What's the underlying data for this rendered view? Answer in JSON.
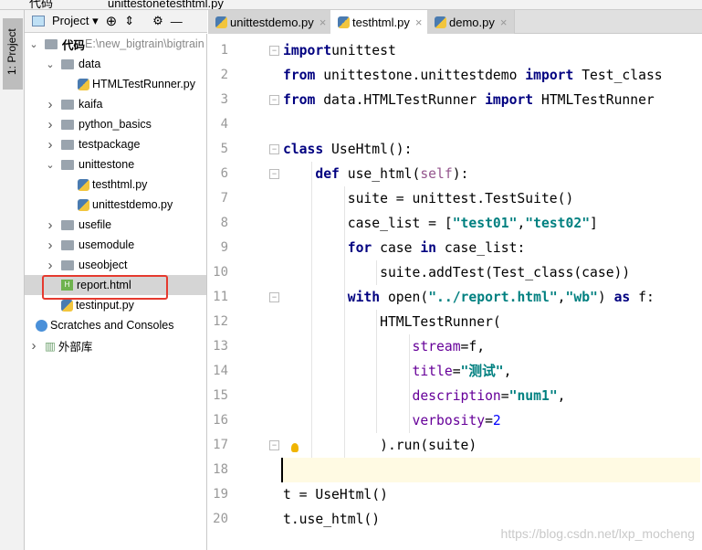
{
  "breadcrumb": [
    "代码",
    "unittestone",
    "testhtml.py"
  ],
  "tool_window": {
    "label": "1: Project",
    "title": "Project"
  },
  "tree": [
    {
      "label": "代码",
      "path": "E:\\new_bigtrain\\bigtrain",
      "type": "folder",
      "depth": 0,
      "expanded": true
    },
    {
      "label": "data",
      "type": "folder",
      "depth": 1,
      "expanded": true
    },
    {
      "label": "HTMLTestRunner.py",
      "type": "py",
      "depth": 2
    },
    {
      "label": "kaifa",
      "type": "folder",
      "depth": 1,
      "expanded": false
    },
    {
      "label": "python_basics",
      "type": "folder",
      "depth": 1,
      "expanded": false
    },
    {
      "label": "testpackage",
      "type": "folder",
      "depth": 1,
      "expanded": false
    },
    {
      "label": "unittestone",
      "type": "folder",
      "depth": 1,
      "expanded": true
    },
    {
      "label": "testhtml.py",
      "type": "py",
      "depth": 2
    },
    {
      "label": "unittestdemo.py",
      "type": "py",
      "depth": 2
    },
    {
      "label": "usefile",
      "type": "folder",
      "depth": 1,
      "expanded": false
    },
    {
      "label": "usemodule",
      "type": "folder",
      "depth": 1,
      "expanded": false
    },
    {
      "label": "useobject",
      "type": "folder",
      "depth": 1,
      "expanded": false
    },
    {
      "label": "report.html",
      "type": "html",
      "depth": 1,
      "selected": true
    },
    {
      "label": "testinput.py",
      "type": "py",
      "depth": 1
    },
    {
      "label": "Scratches and Consoles",
      "type": "scratch",
      "depth": 0
    },
    {
      "label": "外部库",
      "type": "lib",
      "depth": 0,
      "expanded": false
    }
  ],
  "tabs": [
    {
      "label": "unittestdemo.py"
    },
    {
      "label": "testhtml.py",
      "active": true
    },
    {
      "label": "demo.py"
    }
  ],
  "code": [
    [
      [
        "kw",
        "import"
      ],
      [
        "",
        "unittest"
      ]
    ],
    [
      [
        "kw",
        "from"
      ],
      [
        "",
        " unittestone.unittestdemo "
      ],
      [
        "kw",
        "import"
      ],
      [
        "",
        " Test_class"
      ]
    ],
    [
      [
        "kw",
        "from"
      ],
      [
        "",
        " data.HTMLTestRunner "
      ],
      [
        "kw",
        "import"
      ],
      [
        "",
        " HTMLTestRunner"
      ]
    ],
    [],
    [
      [
        "kw",
        "class"
      ],
      [
        "",
        " UseHtml():"
      ]
    ],
    [
      [
        "",
        "    "
      ],
      [
        "kw",
        "def"
      ],
      [
        "",
        " use_html("
      ],
      [
        "self",
        "self"
      ],
      [
        "",
        "):"
      ]
    ],
    [
      [
        "",
        "        suite = unittest.TestSuite()"
      ]
    ],
    [
      [
        "",
        "        case_list = ["
      ],
      [
        "str",
        "\"test01\""
      ],
      [
        "",
        ","
      ],
      [
        "str",
        "\"test02\""
      ],
      [
        "",
        "]"
      ]
    ],
    [
      [
        "",
        "        "
      ],
      [
        "kw",
        "for"
      ],
      [
        "",
        " case "
      ],
      [
        "kw",
        "in"
      ],
      [
        "",
        " case_list:"
      ]
    ],
    [
      [
        "",
        "            suite.addTest(Test_class(case))"
      ]
    ],
    [
      [
        "",
        "        "
      ],
      [
        "kw",
        "with"
      ],
      [
        "",
        " open("
      ],
      [
        "str",
        "\"../report.html\""
      ],
      [
        "",
        ","
      ],
      [
        "str",
        "\"wb\""
      ],
      [
        "",
        ") "
      ],
      [
        "kw",
        "as"
      ],
      [
        "",
        " f:"
      ]
    ],
    [
      [
        "",
        "            HTMLTestRunner("
      ]
    ],
    [
      [
        "",
        "                "
      ],
      [
        "kwarg",
        "stream"
      ],
      [
        "",
        "=f,"
      ]
    ],
    [
      [
        "",
        "                "
      ],
      [
        "kwarg",
        "title"
      ],
      [
        "",
        "="
      ],
      [
        "str",
        "\"测试\""
      ],
      [
        "",
        ","
      ]
    ],
    [
      [
        "",
        "                "
      ],
      [
        "kwarg",
        "description"
      ],
      [
        "",
        "="
      ],
      [
        "str",
        "\"num1\""
      ],
      [
        "",
        ","
      ]
    ],
    [
      [
        "",
        "                "
      ],
      [
        "kwarg",
        "verbosity"
      ],
      [
        "",
        "="
      ],
      [
        "num",
        "2"
      ]
    ],
    [
      [
        "",
        "            ).run(suite)"
      ]
    ],
    [],
    [
      [
        "",
        "t = UseHtml()"
      ]
    ],
    [
      [
        "",
        "t.use_html()"
      ]
    ]
  ],
  "current_line": 18,
  "watermark": "https://blog.csdn.net/lxp_mocheng"
}
